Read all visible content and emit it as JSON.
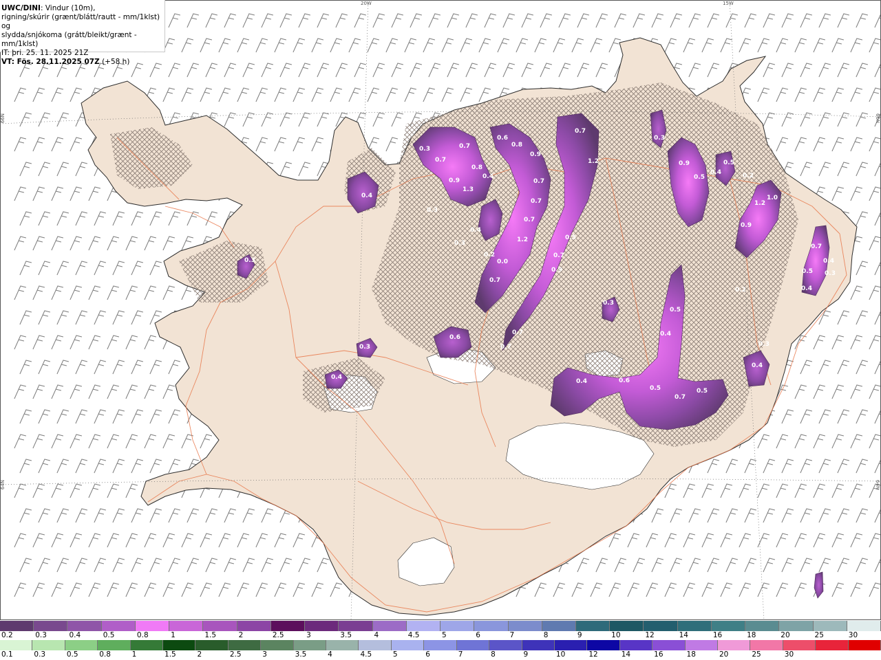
{
  "info": {
    "model": "UWC/DINI",
    "desc_line1": ": Vindur (10m),",
    "desc_line2": "rigning/skúrir (grænt/blátt/rautt - mm/1klst) og",
    "desc_line3": "slydda/snjókoma (grátt/bleikt/grænt - mm/1klst)",
    "it": "IT: þri. 25. 11. 2025 21Z",
    "vt_bold": "VT: Fös. 28.11.2025 07Z",
    "vt_lead": " (+58 h)"
  },
  "coords": {
    "top_20w": "20W",
    "top_15w": "15W",
    "left_66n": "66N",
    "right_66n": "66N",
    "left_64n": "64N",
    "right_64n": "64N"
  },
  "colors": {
    "land": "#f2e3d4",
    "coast": "#2c2c2c",
    "roads": "#e8774a",
    "wind": "#7d7d7d",
    "snow_dark": "#5e3a6e",
    "snow_mid": "#9c4dc0",
    "snow_light": "#f073f5"
  },
  "precip_labels": [
    {
      "text": "0.3"
    },
    {
      "text": "0.7"
    },
    {
      "text": "0.7"
    },
    {
      "text": "0.9"
    },
    {
      "text": "1.3"
    },
    {
      "text": "0.8"
    },
    {
      "text": "0.4"
    },
    {
      "text": "0.6"
    },
    {
      "text": "0.8"
    },
    {
      "text": "0.9"
    },
    {
      "text": "0.7"
    },
    {
      "text": "0.7"
    },
    {
      "text": "1.2"
    },
    {
      "text": "0.4"
    },
    {
      "text": "0.3"
    },
    {
      "text": "0.2"
    },
    {
      "text": "0.7"
    },
    {
      "text": "0.0"
    },
    {
      "text": "0.7"
    },
    {
      "text": "0.7"
    },
    {
      "text": "0.9"
    },
    {
      "text": "0.7"
    },
    {
      "text": "1.2"
    },
    {
      "text": "0.5"
    },
    {
      "text": "0.7"
    },
    {
      "text": "0.7"
    },
    {
      "text": "0.3"
    },
    {
      "text": "0.9"
    },
    {
      "text": "0.5"
    },
    {
      "text": "0.4"
    },
    {
      "text": "0.5"
    },
    {
      "text": "0.2"
    },
    {
      "text": "1.2"
    },
    {
      "text": "1.0"
    },
    {
      "text": "0.9"
    },
    {
      "text": "0.7"
    },
    {
      "text": "0.4"
    },
    {
      "text": "0.5"
    },
    {
      "text": "0.3"
    },
    {
      "text": "0.4"
    },
    {
      "text": "0.2"
    },
    {
      "text": "0.4"
    },
    {
      "text": "0.3"
    },
    {
      "text": "0.3"
    },
    {
      "text": "0.4"
    },
    {
      "text": "0.6"
    },
    {
      "text": "0.3"
    },
    {
      "text": "0.3"
    },
    {
      "text": "0.5"
    },
    {
      "text": "0.4"
    },
    {
      "text": "0.4"
    },
    {
      "text": "0.6"
    },
    {
      "text": "0.5"
    },
    {
      "text": "0.7"
    },
    {
      "text": "0.5"
    },
    {
      "text": "0.3"
    },
    {
      "text": "0.4"
    }
  ],
  "legend_snow": {
    "colors": [
      "#5e3a6e",
      "#79498e",
      "#8f55a8",
      "#b05ec8",
      "#f07af6",
      "#c966d8",
      "#a855bd",
      "#8c45a5",
      "#5c0f5c",
      "#6c2a7c",
      "#7a3e92",
      "#9c6cc6",
      "#b2b2f2",
      "#9ea6e8",
      "#8a96dc",
      "#7c8ccc",
      "#5f7ab0",
      "#2e6a7a",
      "#1d5864",
      "#235e6e",
      "#2f6e7a",
      "#3f7f86",
      "#5a8c91",
      "#7ea3a6",
      "#9db9bb",
      "#e0ecec"
    ],
    "ticks": [
      "0.2",
      "0.3",
      "0.4",
      "0.5",
      "0.8",
      "1",
      "1.5",
      "2",
      "2.5",
      "3",
      "3.5",
      "4",
      "4.5",
      "5",
      "6",
      "7",
      "8",
      "9",
      "10",
      "12",
      "14",
      "16",
      "18",
      "20",
      "25",
      "30"
    ]
  },
  "legend_rain": {
    "colors": [
      "#d9f4d4",
      "#b8e6b0",
      "#8ccf86",
      "#5fae5d",
      "#357a37",
      "#0c4a10",
      "#295c2b",
      "#3e6b42",
      "#5b8460",
      "#7a9d86",
      "#99b3aa",
      "#b4bedd",
      "#a9b2ef",
      "#8c94e5",
      "#6f74d6",
      "#5b55c8",
      "#3e33b9",
      "#2a1fb0",
      "#0d07a4",
      "#5835c6",
      "#8a4fd6",
      "#c07ae4",
      "#f09ad8",
      "#f277a7",
      "#ed4e6a",
      "#e8243a",
      "#e00000"
    ],
    "ticks": [
      "0.1",
      "0.3",
      "0.5",
      "0.8",
      "1",
      "1.5",
      "2",
      "2.5",
      "3",
      "3.5",
      "4",
      "4.5",
      "5",
      "6",
      "7",
      "8",
      "9",
      "10",
      "12",
      "14",
      "16",
      "18",
      "20",
      "25",
      "30"
    ]
  }
}
